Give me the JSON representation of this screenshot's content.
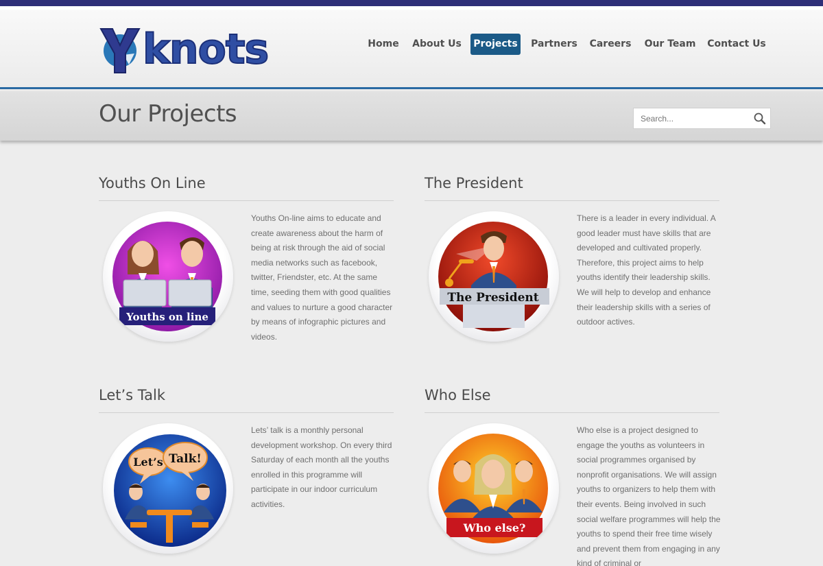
{
  "brand": {
    "logo_text": "knots",
    "logo_initial": "Y"
  },
  "nav": {
    "items": [
      {
        "label": "Home"
      },
      {
        "label": "About Us"
      },
      {
        "label": "Projects",
        "active": true
      },
      {
        "label": "Partners"
      },
      {
        "label": "Careers"
      },
      {
        "label": "Our Team"
      },
      {
        "label": "Contact Us"
      }
    ]
  },
  "page": {
    "title": "Our Projects"
  },
  "search": {
    "placeholder": "Search...",
    "icon": "magnifier-icon"
  },
  "projects": [
    {
      "title": "Youths On Line",
      "banner": "Youths on line",
      "description": "Youths On-line aims to educate and create awareness about the harm of being at risk through the aid of social media networks such as facebook, twitter, Friendster, etc. At the same time, seeding them with good qualities and values to nurture a good character by means of infographic pictures and videos."
    },
    {
      "title": "The President",
      "banner": "The President",
      "description": "There is a leader in every individual. A good leader must have skills that are developed and cultivated properly. Therefore, this project aims to help youths identify their leadership skills. We will help to develop and enhance their leadership skills with a series of outdoor actives."
    },
    {
      "title": "Let’s Talk",
      "bubble_left": "Let’s",
      "bubble_right": "Talk!",
      "description": "Lets’ talk is a monthly personal development workshop. On every third Saturday of each month all the youths enrolled in this programme will participate in our indoor curriculum activities."
    },
    {
      "title": "Who Else",
      "banner": "Who else?",
      "description": "Who else is a project designed to engage the youths as volunteers in social programmes organised by nonprofit organisations. We will assign youths to organizers to help them with their events. Being involved in such social welfare programmes will help the youths to spend their free time wisely and prevent them from engaging in any kind of criminal or"
    }
  ],
  "colors": {
    "topbar": "#2e2f78",
    "accent": "#1b5a87",
    "header_rule": "#2a6aa3"
  }
}
